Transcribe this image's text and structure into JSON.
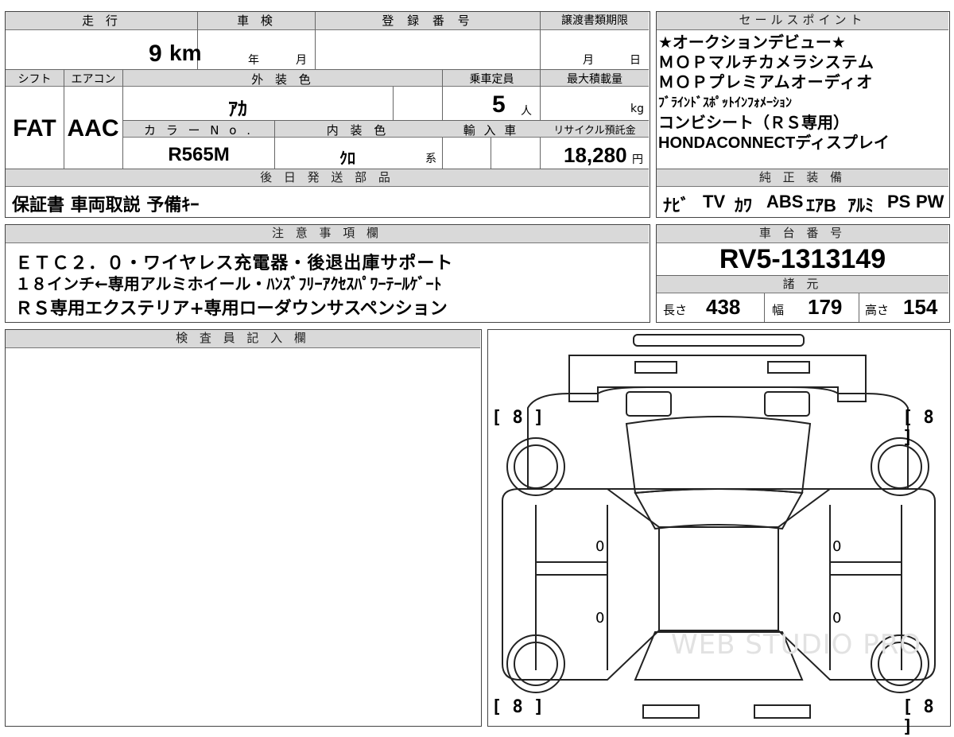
{
  "top": {
    "headers": {
      "mileage": "走 行",
      "inspection": "車 検",
      "registration": "登 録 番 号",
      "transfer_deadline": "譲渡書類期限",
      "sales_points": "セールスポイント"
    },
    "mileage_value": "9",
    "mileage_unit": "km",
    "inspection_year": "年",
    "inspection_month": "月",
    "transfer_month": "月",
    "transfer_day": "日"
  },
  "row2": {
    "headers": {
      "shift": "シフト",
      "aircon": "エアコン",
      "exterior_color": "外 装 色",
      "capacity": "乗車定員",
      "max_load": "最大積載量",
      "color_no": "カ ラ ー N o .",
      "interior_color": "内 装 色",
      "import": "輸 入 車",
      "recycle": "リサイクル預託金"
    },
    "shift_value": "FAT",
    "aircon_value": "AAC",
    "exterior_value": "ｱｶ",
    "capacity_value": "5",
    "capacity_unit": "人",
    "load_unit": "kg",
    "color_no_value": "R565M",
    "interior_value": "ｸﾛ",
    "interior_suffix": "系",
    "recycle_value": "18,280",
    "recycle_unit": "円"
  },
  "sales_points": [
    "★オークションデビュー★",
    "ＭＯＰマルチカメラシステム",
    "ＭＯＰプレミアムオーディオ",
    "ﾌﾞﾗｲﾝﾄﾞｽﾎﾟｯﾄｲﾝﾌｫﾒｰｼｮﾝ",
    "コンビシート（ＲＳ専用）",
    "HONDACONNECTディスプレイ"
  ],
  "parts": {
    "header": "後 日 発 送 部 品",
    "value": "保証書 車両取説 予備ｷｰ"
  },
  "equipment": {
    "header": "純 正 装 備",
    "items": [
      "ﾅﾋﾞ",
      "TV",
      "ｶﾜ",
      "ABS",
      "ｴｱB",
      "ｱﾙﾐ",
      "PS",
      "PW"
    ]
  },
  "notes": {
    "header": "注 意 事 項 欄",
    "lines": [
      "ＥＴＣ２．０・ワイヤレス充電器・後退出庫サポート",
      "１８インチ←専用アルミホイール・ﾊﾝｽﾞﾌﾘｰｱｸｾｽﾊﾟﾜｰﾃｰﾙｹﾞｰﾄ",
      "ＲＳ専用エクステリア+専用ローダウンサスペンション"
    ]
  },
  "chassis": {
    "header": "車 台 番 号",
    "value": "RV5-1313149"
  },
  "specs": {
    "header": "諸 元",
    "length_label": "長さ",
    "length_value": "438",
    "width_label": "幅",
    "width_value": "179",
    "height_label": "高さ",
    "height_value": "154"
  },
  "inspector": {
    "header": "検 査 員 記 入 欄"
  },
  "diagram": {
    "tire_fl": "[ 8 ]",
    "tire_fr": "[ 8 ]",
    "tire_rl": "[ 8 ]",
    "tire_rr": "[ 8 ]",
    "door_1": "0",
    "door_2": "0",
    "door_3": "0",
    "door_4": "0",
    "watermark": "WEB STUDIO PRO"
  }
}
